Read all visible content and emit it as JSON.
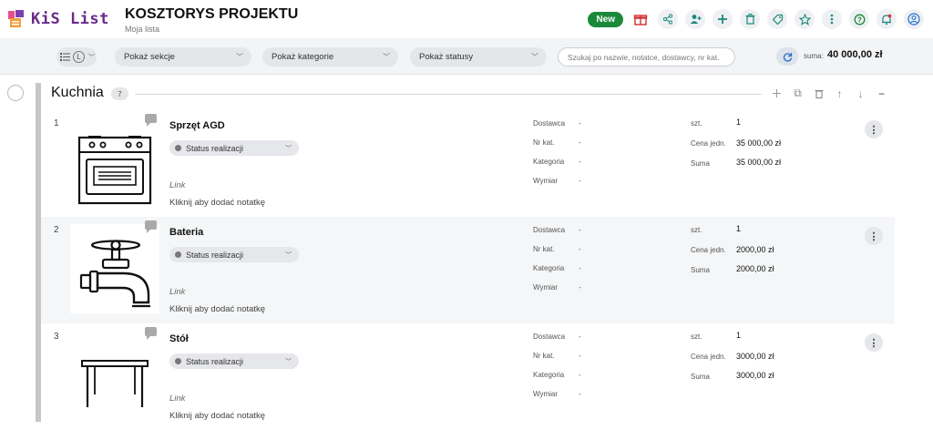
{
  "app": {
    "logo_text": "KiS List",
    "title": "KOSZTORYS PROJEKTU",
    "subtitle": "Moja lista"
  },
  "toolbar": {
    "new_badge": "New",
    "icons": [
      "gift-icon",
      "share-icon",
      "add-user-icon",
      "add-icon",
      "trash-icon",
      "discount-tag-icon",
      "star-icon",
      "more-vert-icon",
      "help-icon",
      "notification-icon",
      "account-icon"
    ]
  },
  "filters": {
    "view_toggle_letter": "L",
    "sections": "Pokaż sekcje",
    "categories": "Pokaż kategorie",
    "statuses": "Pokaż statusy",
    "search_placeholder": "Szukaj po nazwie, notatce, dostawcy, nr kat.",
    "sum_label": "suma:",
    "sum_value": "40 000,00 zł"
  },
  "section": {
    "title": "Kuchnia",
    "count": "7"
  },
  "labels": {
    "supplier": "Dostawca",
    "catalog": "Nr kat.",
    "category": "Kategoria",
    "dimension": "Wymiar",
    "qty": "szt.",
    "unit_price": "Cena jedn.",
    "total": "Suma",
    "status": "Status realizacji",
    "link": "Link",
    "note": "Kliknij aby dodać notatkę",
    "dash": "-"
  },
  "items": [
    {
      "num": "1",
      "name": "Sprzęt AGD",
      "qty": "1",
      "unit_price": "35 000,00 zł",
      "total": "35 000,00 zł",
      "image": "oven-icon"
    },
    {
      "num": "2",
      "name": "Bateria",
      "qty": "1",
      "unit_price": "2000,00 zł",
      "total": "2000,00 zł",
      "image": "faucet-icon"
    },
    {
      "num": "3",
      "name": "Stół",
      "qty": "1",
      "unit_price": "3000,00 zł",
      "total": "3000,00 zł",
      "image": "table-icon"
    }
  ]
}
